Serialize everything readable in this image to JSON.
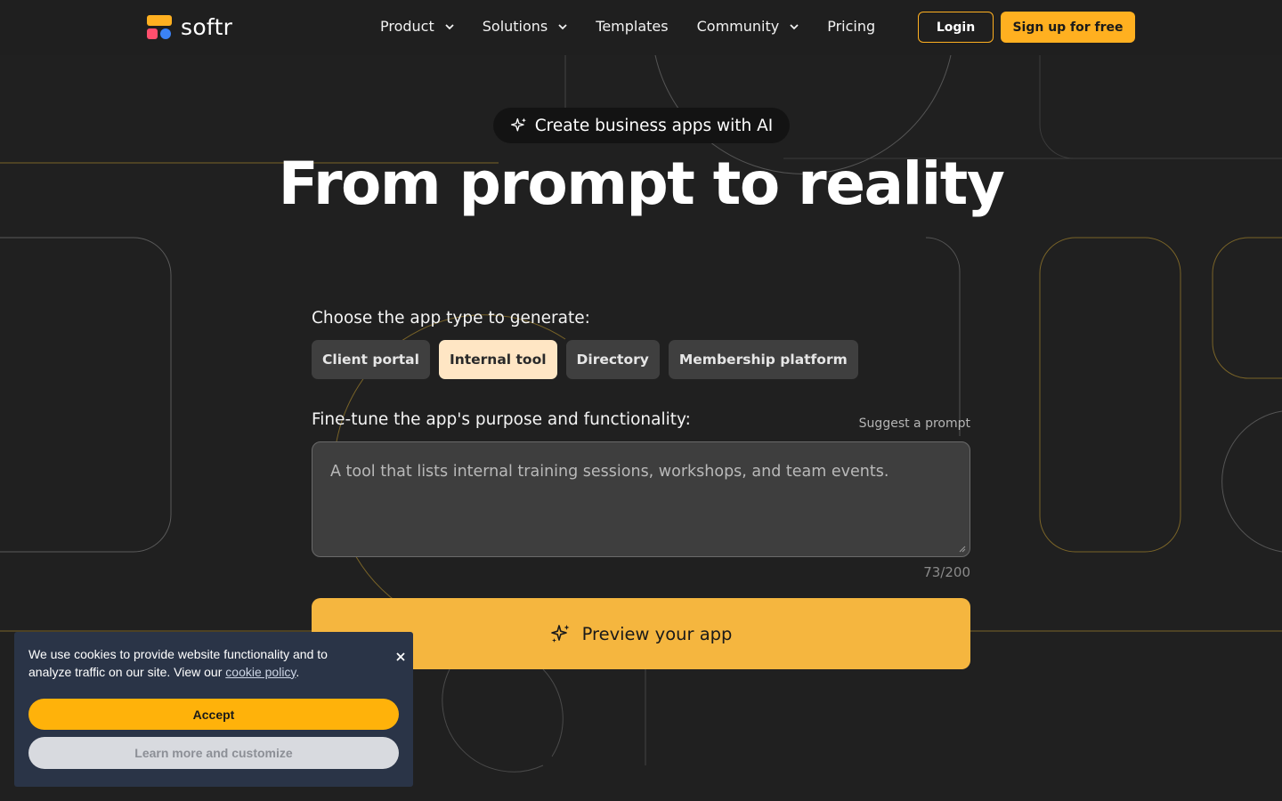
{
  "brand": {
    "name": "softr",
    "accent": "#ffb020"
  },
  "nav": {
    "items": [
      {
        "label": "Product",
        "dropdown": true
      },
      {
        "label": "Solutions",
        "dropdown": true
      },
      {
        "label": "Templates",
        "dropdown": false
      },
      {
        "label": "Community",
        "dropdown": true
      },
      {
        "label": "Pricing",
        "dropdown": false
      }
    ],
    "login_label": "Login",
    "signup_label": "Sign up for free"
  },
  "hero": {
    "badge": "Create business apps with AI",
    "title": "From prompt to reality"
  },
  "generator": {
    "app_type_label": "Choose the app type to generate:",
    "app_types": [
      {
        "label": "Client portal",
        "selected": false
      },
      {
        "label": "Internal tool",
        "selected": true
      },
      {
        "label": "Directory",
        "selected": false
      },
      {
        "label": "Membership platform",
        "selected": false
      }
    ],
    "purpose_label": "Fine-tune the app's purpose and functionality:",
    "suggest_label": "Suggest a prompt",
    "prompt_text": "A tool that lists internal training sessions, workshops, and team events.",
    "counter": "73/200",
    "preview_label": "Preview your app"
  },
  "cookie": {
    "message": "We use cookies to provide website functionality and to analyze traffic on our site. View our",
    "link_text": "cookie policy",
    "suffix": ".",
    "accept_label": "Accept",
    "learn_label": "Learn more and customize"
  }
}
